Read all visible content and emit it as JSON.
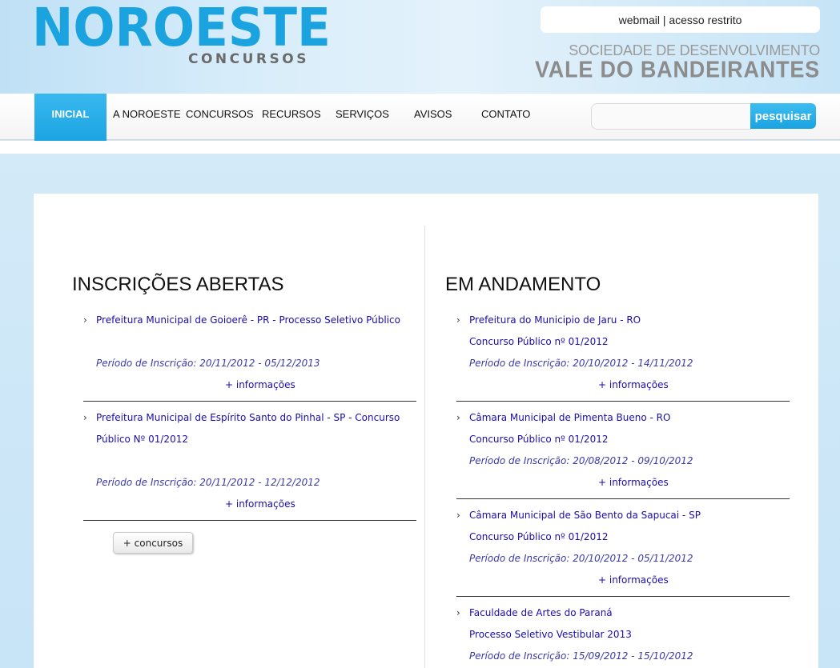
{
  "header": {
    "logo_main": "NOROESTE",
    "logo_sub": "CONCURSOS",
    "webmail_label": "webmail | acesso restrito",
    "org_line1": "SOCIEDADE DE DESENVOLVIMENTO",
    "org_line2": "VALE DO BANDEIRANTES"
  },
  "nav": {
    "items": [
      "INICIAL",
      "A NOROESTE",
      "CONCURSOS",
      "RECURSOS",
      "SERVIÇOS",
      "AVISOS",
      "CONTATO"
    ],
    "active": "INICIAL",
    "search_placeholder": "",
    "search_button": "pesquisar"
  },
  "colors": {
    "brand_blue": "#1ba3e0",
    "link_blue": "#1a0dab"
  },
  "open": {
    "title": "INSCRIÇÕES ABERTAS",
    "entries": [
      {
        "title_lines": [
          "Prefeitura Municipal de Goioerê - PR - Processo Seletivo Público"
        ],
        "subtitle": "",
        "period": "Período de Inscrição: 20/11/2012 - 05/12/2013",
        "more": "+ informações"
      },
      {
        "title_lines": [
          "Prefeitura Municipal de Espírito Santo do Pinhal - SP - Concurso",
          "Público Nº 01/2012"
        ],
        "subtitle": "",
        "period": "Período de Inscrição: 20/11/2012 - 12/12/2012",
        "more": "+ informações"
      }
    ],
    "more_button": "+ concursos"
  },
  "ongoing": {
    "title": "EM ANDAMENTO",
    "entries": [
      {
        "title_lines": [
          "Prefeitura do Municipio de Jaru - RO"
        ],
        "subtitle": "Concurso Público nº 01/2012",
        "period": "Período de Inscrição: 20/10/2012 - 14/11/2012",
        "more": "+ informações"
      },
      {
        "title_lines": [
          "Câmara Municipal de Pimenta Bueno - RO"
        ],
        "subtitle": "Concurso Público nº 01/2012",
        "period": "Período de Inscrição: 20/08/2012 - 09/10/2012",
        "more": "+ informações"
      },
      {
        "title_lines": [
          "Câmara Municipal de São Bento da Sapucai - SP"
        ],
        "subtitle": "Concurso Público nº 01/2012",
        "period": "Período de Inscrição: 20/10/2012 - 05/11/2012",
        "more": "+ informações"
      },
      {
        "title_lines": [
          "Faculdade de Artes do Paraná"
        ],
        "subtitle": "Processo Seletivo Vestibular 2013",
        "period": "Período de Inscrição: 15/09/2012 - 15/10/2012",
        "more": ""
      }
    ]
  }
}
